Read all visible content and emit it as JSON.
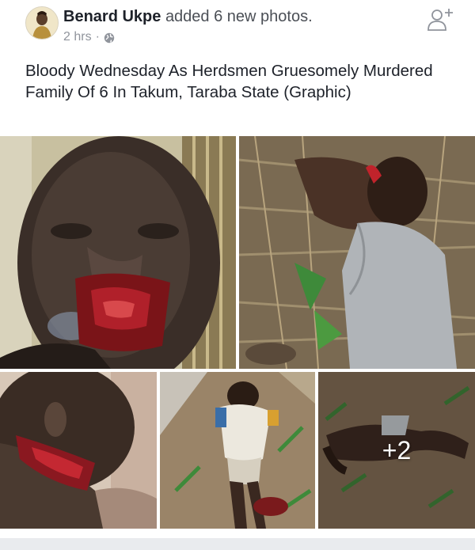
{
  "post": {
    "author": "Benard Ukpe",
    "action": "added 6 new photos.",
    "time": "2 hrs",
    "separator": "·",
    "privacy_icon": "globe-icon",
    "text": "Bloody Wednesday As Herdsmen Gruesomely Murdered Family Of 6 In Takum, Taraba State (Graphic)"
  },
  "header": {
    "add_friend_icon": "add-friend-icon"
  },
  "photos": {
    "count_shown": 5,
    "more_label": "+2"
  },
  "colors": {
    "name": "#1d2129",
    "meta": "#90949c",
    "background": "#e9ebee"
  }
}
